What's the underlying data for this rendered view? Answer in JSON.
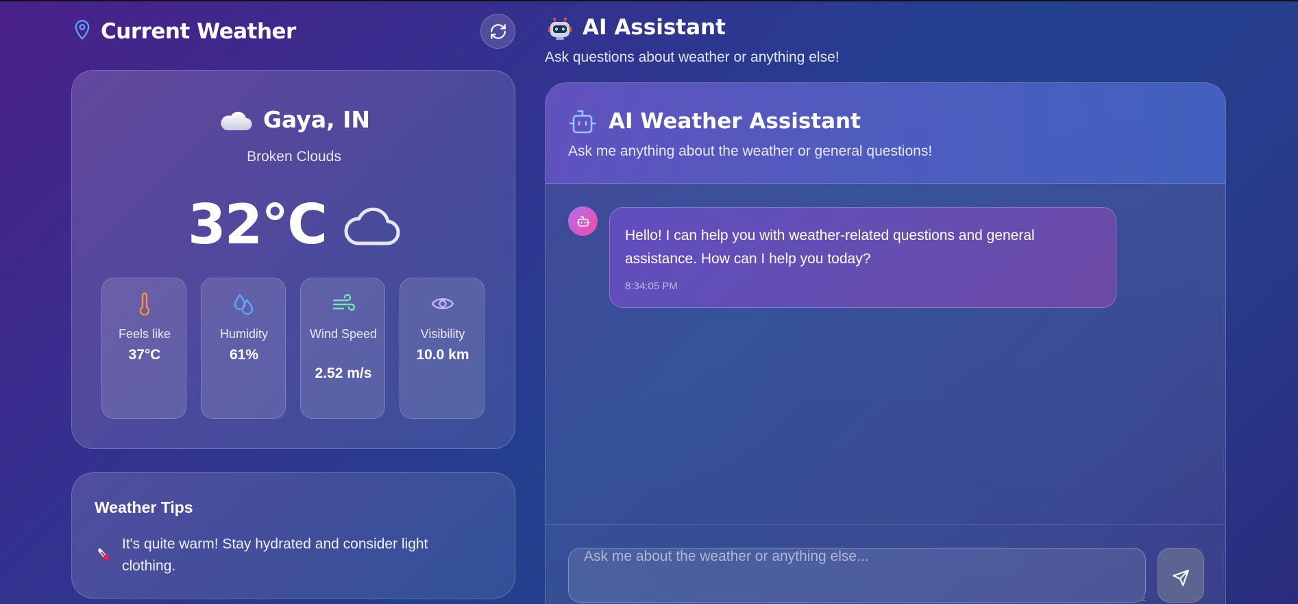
{
  "left": {
    "title": "Current Weather",
    "icons": {
      "location": "map-pin-icon",
      "refresh": "refresh-icon"
    }
  },
  "weather": {
    "city": "Gaya, IN",
    "description": "Broken Clouds",
    "temperature": "32°C",
    "stats": [
      {
        "label": "Feels like",
        "value": "37°C",
        "icon": "thermometer-icon"
      },
      {
        "label": "Humidity",
        "value": "61%",
        "icon": "droplets-icon"
      },
      {
        "label": "Wind Speed",
        "value": "2.52 m/s",
        "icon": "wind-icon"
      },
      {
        "label": "Visibility",
        "value": "10.0 km",
        "icon": "eye-icon"
      }
    ]
  },
  "tips": {
    "title": "Weather Tips",
    "items": [
      {
        "text": "It's quite warm! Stay hydrated and consider light clothing.",
        "icon": "thermometer-emoji-icon"
      }
    ]
  },
  "assistant": {
    "title": "AI Assistant",
    "subtitle": "Ask questions about weather or anything else!",
    "chat_title": "AI Weather Assistant",
    "chat_subtitle": "Ask me anything about the weather or general questions!",
    "messages": [
      {
        "sender": "bot",
        "text": "Hello! I can help you with weather-related questions and general assistance. How can I help you today?",
        "time": "8:34:05 PM"
      }
    ],
    "input_placeholder": "Ask me about the weather or anything else...",
    "send_icon": "send-icon"
  },
  "colors": {
    "accent_blue": "#60a5fa",
    "thermo_orange": "#fb923c",
    "wind_green": "#6ee7b7",
    "eye_purple": "#c4b5fd",
    "avatar_pink": "#ec4fa4"
  }
}
